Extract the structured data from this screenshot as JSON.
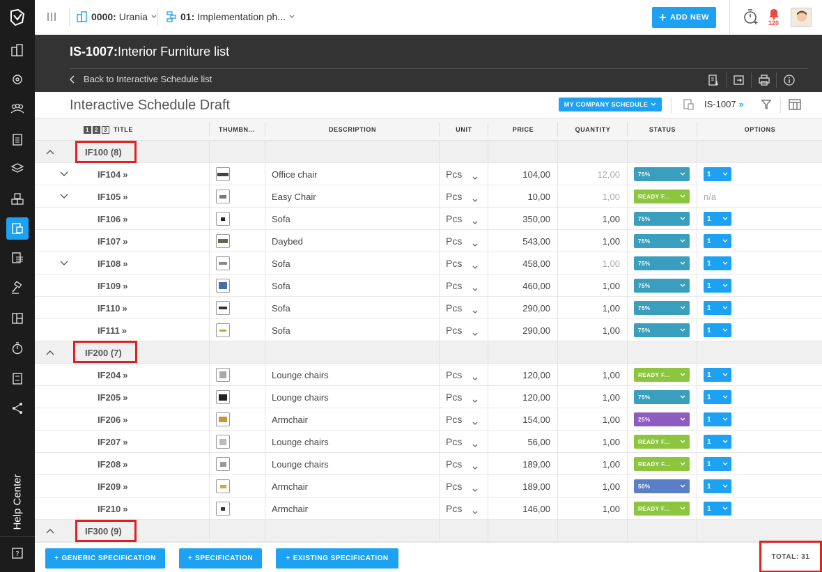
{
  "topbar": {
    "project_code": "0000:",
    "project_name": "Urania",
    "phase_code": "01:",
    "phase_name": "Implementation ph...",
    "add_new_label": "ADD NEW",
    "notification_count": "120"
  },
  "header": {
    "code": "IS-1007:",
    "title": "Interior Furniture list",
    "back_label": "Back to Interactive Schedule list"
  },
  "subheader": {
    "title": "Interactive Schedule Draft",
    "schedule_button": "MY COMPANY SCHEDULE",
    "schedule_code": "IS-1007",
    "code_arrow": "»"
  },
  "table": {
    "levels": [
      "1",
      "2",
      "3"
    ],
    "columns": [
      "TITLE",
      "THUMBN...",
      "DESCRIPTION",
      "UNIT",
      "PRICE",
      "QUANTITY",
      "STATUS",
      "OPTIONS"
    ],
    "groups": [
      {
        "label": "IF100 (8)",
        "items": [
          {
            "code": "IF104",
            "desc": "Office chair",
            "unit": "Pcs",
            "price": "104,00",
            "qty": "12,00",
            "qty_grey": true,
            "status": "75%",
            "status_color": "#3a9fbf",
            "option": "1",
            "expand": true
          },
          {
            "code": "IF105",
            "desc": "Easy Chair",
            "unit": "Pcs",
            "price": "10,00",
            "qty": "1,00",
            "qty_grey": true,
            "status": "READY F...",
            "status_color": "#8cc63f",
            "option": "n/a",
            "expand": true
          },
          {
            "code": "IF106",
            "desc": "Sofa",
            "unit": "Pcs",
            "price": "350,00",
            "qty": "1,00",
            "qty_grey": false,
            "status": "75%",
            "status_color": "#3a9fbf",
            "option": "1",
            "expand": false
          },
          {
            "code": "IF107",
            "desc": "Daybed",
            "unit": "Pcs",
            "price": "543,00",
            "qty": "1,00",
            "qty_grey": false,
            "status": "75%",
            "status_color": "#3a9fbf",
            "option": "1",
            "expand": false
          },
          {
            "code": "IF108",
            "desc": "Sofa",
            "unit": "Pcs",
            "price": "458,00",
            "qty": "1,00",
            "qty_grey": true,
            "status": "75%",
            "status_color": "#3a9fbf",
            "option": "1",
            "expand": true
          },
          {
            "code": "IF109",
            "desc": "Sofa",
            "unit": "Pcs",
            "price": "460,00",
            "qty": "1,00",
            "qty_grey": false,
            "status": "75%",
            "status_color": "#3a9fbf",
            "option": "1",
            "expand": false
          },
          {
            "code": "IF110",
            "desc": "Sofa",
            "unit": "Pcs",
            "price": "290,00",
            "qty": "1,00",
            "qty_grey": false,
            "status": "75%",
            "status_color": "#3a9fbf",
            "option": "1",
            "expand": false
          },
          {
            "code": "IF111",
            "desc": "Sofa",
            "unit": "Pcs",
            "price": "290,00",
            "qty": "1,00",
            "qty_grey": false,
            "status": "75%",
            "status_color": "#3a9fbf",
            "option": "1",
            "expand": false
          }
        ]
      },
      {
        "label": "IF200 (7)",
        "items": [
          {
            "code": "IF204",
            "desc": "Lounge chairs",
            "unit": "Pcs",
            "price": "120,00",
            "qty": "1,00",
            "qty_grey": false,
            "status": "READY F...",
            "status_color": "#8cc63f",
            "option": "1",
            "expand": false
          },
          {
            "code": "IF205",
            "desc": "Lounge chairs",
            "unit": "Pcs",
            "price": "120,00",
            "qty": "1,00",
            "qty_grey": false,
            "status": "75%",
            "status_color": "#3a9fbf",
            "option": "1",
            "expand": false
          },
          {
            "code": "IF206",
            "desc": "Armchair",
            "unit": "Pcs",
            "price": "154,00",
            "qty": "1,00",
            "qty_grey": false,
            "status": "25%",
            "status_color": "#8e5bc0",
            "option": "1",
            "expand": false
          },
          {
            "code": "IF207",
            "desc": "Lounge chairs",
            "unit": "Pcs",
            "price": "56,00",
            "qty": "1,00",
            "qty_grey": false,
            "status": "READY F...",
            "status_color": "#8cc63f",
            "option": "1",
            "expand": false
          },
          {
            "code": "IF208",
            "desc": "Lounge chairs",
            "unit": "Pcs",
            "price": "189,00",
            "qty": "1,00",
            "qty_grey": false,
            "status": "READY F...",
            "status_color": "#8cc63f",
            "option": "1",
            "expand": false
          },
          {
            "code": "IF209",
            "desc": "Armchair",
            "unit": "Pcs",
            "price": "189,00",
            "qty": "1,00",
            "qty_grey": false,
            "status": "50%",
            "status_color": "#5b7fc7",
            "option": "1",
            "expand": false
          },
          {
            "code": "IF210",
            "desc": "Armchair",
            "unit": "Pcs",
            "price": "146,00",
            "qty": "1,00",
            "qty_grey": false,
            "status": "READY F...",
            "status_color": "#8cc63f",
            "option": "1",
            "expand": false
          }
        ]
      },
      {
        "label": "IF300 (9)",
        "items": []
      }
    ]
  },
  "footer": {
    "buttons": [
      "GENERIC SPECIFICATION",
      "SPECIFICATION",
      "EXISTING SPECIFICATION"
    ],
    "total_label": "TOTAL: 31"
  },
  "sidebar": {
    "help_center": "Help Center"
  },
  "colors": {
    "accent": "#1da1f2",
    "highlight": "#e02020",
    "dark": "#333333",
    "sidebar": "#1c1c1c"
  }
}
